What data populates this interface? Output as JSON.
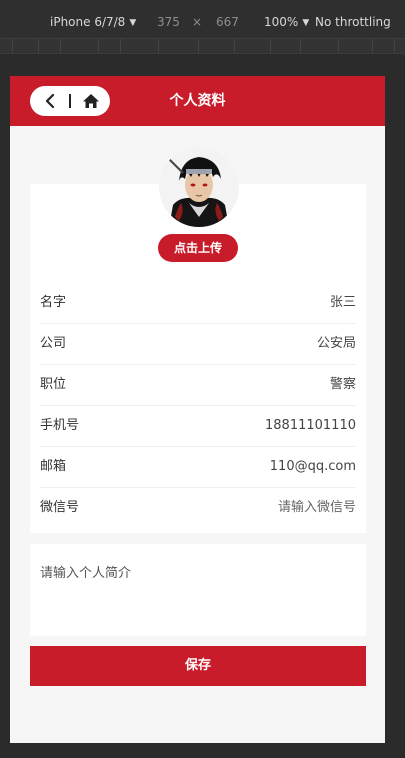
{
  "devtools": {
    "device": "iPhone 6/7/8",
    "width": "375",
    "times": "×",
    "height": "667",
    "zoom": "100%",
    "throttling": "No throttling"
  },
  "header": {
    "title": "个人资料",
    "back_icon": "chevron-left-icon",
    "home_icon": "home-icon",
    "color": "#c81c2b"
  },
  "profile": {
    "upload_label": "点击上传",
    "fields": [
      {
        "label": "名字",
        "value": "张三"
      },
      {
        "label": "公司",
        "value": "公安局"
      },
      {
        "label": "职位",
        "value": "警察"
      },
      {
        "label": "手机号",
        "value": "18811101110"
      },
      {
        "label": "邮箱",
        "value": "110@qq.com"
      },
      {
        "label": "微信号",
        "placeholder": "请输入微信号"
      }
    ]
  },
  "bio": {
    "placeholder": "请输入个人简介"
  },
  "save_label": "保存"
}
